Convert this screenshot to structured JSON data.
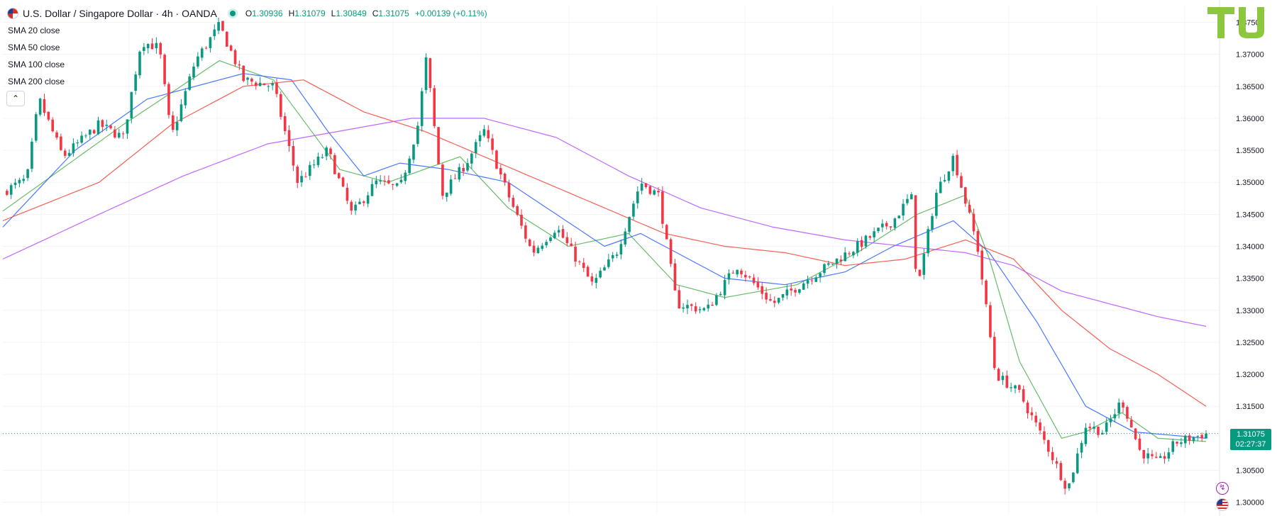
{
  "header": {
    "title": "U.S. Dollar / Singapore Dollar · 4h · OANDA",
    "ohlc": [
      {
        "k": "O",
        "v": "1.30936"
      },
      {
        "k": "H",
        "v": "1.31079"
      },
      {
        "k": "L",
        "v": "1.30849"
      },
      {
        "k": "C",
        "v": "1.31075"
      }
    ],
    "change": "+0.00139 (+0.11%)"
  },
  "legend": {
    "items": [
      "SMA 20 close",
      "SMA 50 close",
      "SMA 100 close",
      "SMA 200 close"
    ]
  },
  "price_tag": {
    "price": "1.31075",
    "countdown": "02:27:37"
  },
  "logo_text": "TU",
  "colors": {
    "up": "#089981",
    "down": "#f23645",
    "sma20": "#4caf50",
    "sma50": "#2962ff",
    "sma100": "#f44336",
    "sma200": "#b74cff",
    "brand": "#8dc63f"
  },
  "chart_data": {
    "type": "candlestick",
    "symbol": "USDSGD",
    "timeframe": "4h",
    "current_price": 1.31075,
    "ylim": [
      1.2983,
      1.3776
    ],
    "y_ticks": [
      "1.30000",
      "1.30500",
      "1.31500",
      "1.32000",
      "1.32500",
      "1.33000",
      "1.33500",
      "1.34000",
      "1.34500",
      "1.35000",
      "1.35500",
      "1.36000",
      "1.36500",
      "1.37000",
      "1.37500"
    ],
    "grid": true,
    "price_path": [
      [
        0,
        1.3485
      ],
      [
        0.02,
        1.3505
      ],
      [
        0.03,
        1.363
      ],
      [
        0.05,
        1.354
      ],
      [
        0.08,
        1.359
      ],
      [
        0.1,
        1.357
      ],
      [
        0.115,
        1.372
      ],
      [
        0.13,
        1.371
      ],
      [
        0.14,
        1.357
      ],
      [
        0.16,
        1.369
      ],
      [
        0.18,
        1.3745
      ],
      [
        0.2,
        1.366
      ],
      [
        0.225,
        1.365
      ],
      [
        0.245,
        1.35
      ],
      [
        0.27,
        1.355
      ],
      [
        0.29,
        1.345
      ],
      [
        0.31,
        1.35
      ],
      [
        0.33,
        1.349
      ],
      [
        0.345,
        1.359
      ],
      [
        0.352,
        1.3695
      ],
      [
        0.365,
        1.348
      ],
      [
        0.385,
        1.353
      ],
      [
        0.4,
        1.358
      ],
      [
        0.42,
        1.348
      ],
      [
        0.44,
        1.339
      ],
      [
        0.46,
        1.343
      ],
      [
        0.49,
        1.334
      ],
      [
        0.51,
        1.339
      ],
      [
        0.53,
        1.35
      ],
      [
        0.545,
        1.348
      ],
      [
        0.56,
        1.331
      ],
      [
        0.585,
        1.33
      ],
      [
        0.61,
        1.337
      ],
      [
        0.64,
        1.331
      ],
      [
        0.67,
        1.335
      ],
      [
        0.71,
        1.34
      ],
      [
        0.74,
        1.344
      ],
      [
        0.755,
        1.348
      ],
      [
        0.76,
        1.333
      ],
      [
        0.775,
        1.348
      ],
      [
        0.79,
        1.354
      ],
      [
        0.81,
        1.34
      ],
      [
        0.825,
        1.32
      ],
      [
        0.845,
        1.317
      ],
      [
        0.87,
        1.308
      ],
      [
        0.885,
        1.302
      ],
      [
        0.9,
        1.312
      ],
      [
        0.915,
        1.311
      ],
      [
        0.93,
        1.316
      ],
      [
        0.945,
        1.308
      ],
      [
        0.96,
        1.306
      ],
      [
        0.975,
        1.30936
      ],
      [
        1.0,
        1.31075
      ]
    ],
    "sma_paths": {
      "SMA 20 close": [
        [
          0,
          1.3455
        ],
        [
          0.1,
          1.359
        ],
        [
          0.18,
          1.369
        ],
        [
          0.225,
          1.366
        ],
        [
          0.28,
          1.352
        ],
        [
          0.32,
          1.35
        ],
        [
          0.38,
          1.354
        ],
        [
          0.42,
          1.346
        ],
        [
          0.47,
          1.34
        ],
        [
          0.52,
          1.342
        ],
        [
          0.56,
          1.334
        ],
        [
          0.6,
          1.332
        ],
        [
          0.66,
          1.334
        ],
        [
          0.71,
          1.339
        ],
        [
          0.76,
          1.345
        ],
        [
          0.8,
          1.348
        ],
        [
          0.82,
          1.338
        ],
        [
          0.845,
          1.322
        ],
        [
          0.88,
          1.31
        ],
        [
          0.9,
          1.311
        ],
        [
          0.93,
          1.314
        ],
        [
          0.96,
          1.31
        ],
        [
          1.0,
          1.3095
        ]
      ],
      "SMA 50 close": [
        [
          0,
          1.343
        ],
        [
          0.06,
          1.355
        ],
        [
          0.12,
          1.363
        ],
        [
          0.2,
          1.367
        ],
        [
          0.24,
          1.366
        ],
        [
          0.27,
          1.358
        ],
        [
          0.3,
          1.351
        ],
        [
          0.33,
          1.353
        ],
        [
          0.37,
          1.352
        ],
        [
          0.42,
          1.35
        ],
        [
          0.46,
          1.345
        ],
        [
          0.5,
          1.34
        ],
        [
          0.53,
          1.342
        ],
        [
          0.56,
          1.339
        ],
        [
          0.6,
          1.335
        ],
        [
          0.65,
          1.334
        ],
        [
          0.7,
          1.336
        ],
        [
          0.74,
          1.34
        ],
        [
          0.79,
          1.344
        ],
        [
          0.82,
          1.339
        ],
        [
          0.86,
          1.328
        ],
        [
          0.9,
          1.315
        ],
        [
          0.94,
          1.311
        ],
        [
          1.0,
          1.31
        ]
      ],
      "SMA 100 close": [
        [
          0,
          1.344
        ],
        [
          0.08,
          1.35
        ],
        [
          0.14,
          1.359
        ],
        [
          0.2,
          1.365
        ],
        [
          0.25,
          1.366
        ],
        [
          0.3,
          1.361
        ],
        [
          0.35,
          1.358
        ],
        [
          0.4,
          1.354
        ],
        [
          0.45,
          1.35
        ],
        [
          0.5,
          1.346
        ],
        [
          0.55,
          1.342
        ],
        [
          0.6,
          1.34
        ],
        [
          0.65,
          1.339
        ],
        [
          0.7,
          1.337
        ],
        [
          0.75,
          1.338
        ],
        [
          0.8,
          1.341
        ],
        [
          0.84,
          1.338
        ],
        [
          0.88,
          1.33
        ],
        [
          0.92,
          1.324
        ],
        [
          0.96,
          1.32
        ],
        [
          1.0,
          1.315
        ]
      ],
      "SMA 200 close": [
        [
          0,
          1.338
        ],
        [
          0.08,
          1.345
        ],
        [
          0.15,
          1.351
        ],
        [
          0.22,
          1.356
        ],
        [
          0.28,
          1.358
        ],
        [
          0.34,
          1.36
        ],
        [
          0.4,
          1.36
        ],
        [
          0.46,
          1.357
        ],
        [
          0.52,
          1.351
        ],
        [
          0.58,
          1.346
        ],
        [
          0.64,
          1.343
        ],
        [
          0.7,
          1.341
        ],
        [
          0.75,
          1.34
        ],
        [
          0.8,
          1.339
        ],
        [
          0.84,
          1.337
        ],
        [
          0.88,
          1.333
        ],
        [
          0.92,
          1.331
        ],
        [
          0.96,
          1.329
        ],
        [
          1.0,
          1.3275
        ]
      ]
    }
  }
}
